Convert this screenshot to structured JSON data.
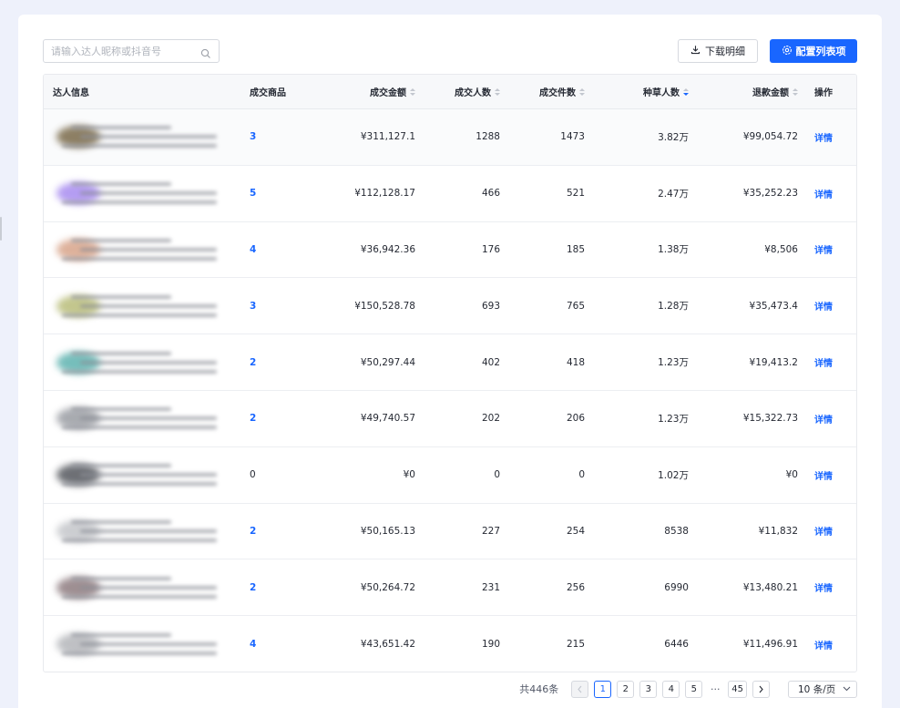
{
  "search": {
    "placeholder": "请输入达人昵称或抖音号",
    "value": ""
  },
  "toolbar": {
    "download_label": "下载明细",
    "config_label": "配置列表项"
  },
  "table": {
    "columns": {
      "info": "达人信息",
      "goods": "成交商品",
      "amount": "成交金额",
      "buyers": "成交人数",
      "items": "成交件数",
      "grass": "种草人数",
      "refund": "退款金额",
      "op": "操作"
    },
    "rows": [
      {
        "goods": "3",
        "amount": "¥311,127.1",
        "buyers": "1288",
        "items": "1473",
        "grass": "3.82万",
        "refund": "¥99,054.72",
        "op": "详情",
        "avatar_color": "#7a6a4a"
      },
      {
        "goods": "5",
        "amount": "¥112,128.17",
        "buyers": "466",
        "items": "521",
        "grass": "2.47万",
        "refund": "¥35,252.23",
        "op": "详情",
        "avatar_color": "#a88cf0"
      },
      {
        "goods": "4",
        "amount": "¥36,942.36",
        "buyers": "176",
        "items": "185",
        "grass": "1.38万",
        "refund": "¥8,506",
        "op": "详情",
        "avatar_color": "#d8a48a"
      },
      {
        "goods": "3",
        "amount": "¥150,528.78",
        "buyers": "693",
        "items": "765",
        "grass": "1.28万",
        "refund": "¥35,473.4",
        "op": "详情",
        "avatar_color": "#b9bd7a"
      },
      {
        "goods": "2",
        "amount": "¥50,297.44",
        "buyers": "402",
        "items": "418",
        "grass": "1.23万",
        "refund": "¥19,413.2",
        "op": "详情",
        "avatar_color": "#5fb3b0"
      },
      {
        "goods": "2",
        "amount": "¥49,740.57",
        "buyers": "202",
        "items": "206",
        "grass": "1.23万",
        "refund": "¥15,322.73",
        "op": "详情",
        "avatar_color": "#9a9da3"
      },
      {
        "goods": "0",
        "amount": "¥0",
        "buyers": "0",
        "items": "0",
        "grass": "1.02万",
        "refund": "¥0",
        "op": "详情",
        "avatar_color": "#55585e"
      },
      {
        "goods": "2",
        "amount": "¥50,165.13",
        "buyers": "227",
        "items": "254",
        "grass": "8538",
        "refund": "¥11,832",
        "op": "详情",
        "avatar_color": "#c4c6ca"
      },
      {
        "goods": "2",
        "amount": "¥50,264.72",
        "buyers": "231",
        "items": "256",
        "grass": "6990",
        "refund": "¥13,480.21",
        "op": "详情",
        "avatar_color": "#8e7c80"
      },
      {
        "goods": "4",
        "amount": "¥43,651.42",
        "buyers": "190",
        "items": "215",
        "grass": "6446",
        "refund": "¥11,496.91",
        "op": "详情",
        "avatar_color": "#b4b6ba"
      }
    ]
  },
  "pagination": {
    "total": "共446条",
    "pages": [
      "1",
      "2",
      "3",
      "4",
      "5"
    ],
    "ellipsis": "···",
    "last_page": "45",
    "page_size": "10 条/页"
  },
  "colors": {
    "primary": "#1966ff",
    "background": "#eef1fb"
  }
}
